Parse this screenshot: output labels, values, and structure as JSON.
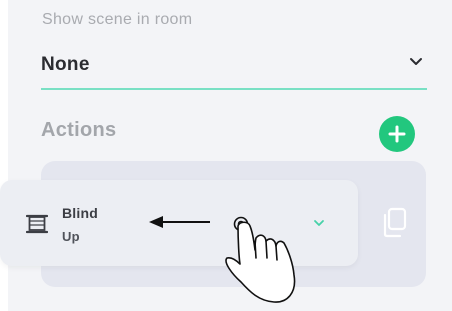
{
  "scene": {
    "label": "Show scene in room",
    "selected_value": "None",
    "dropdown_icon": "chevron-down-icon"
  },
  "actions": {
    "title": "Actions",
    "add_icon": "plus-icon",
    "items": [
      {
        "name": "Blind",
        "state": "Up",
        "icon": "blind-icon",
        "expand_icon": "chevron-down-icon"
      }
    ],
    "copy_icon": "copy-icon"
  },
  "gesture": {
    "icon": "hand-pointer-icon",
    "direction_icon": "arrow-left-icon"
  },
  "colors": {
    "accent_green": "#22c77e",
    "underline_teal": "#79e0c4",
    "chevron_teal": "#46d1a8",
    "background": "#f3f4f7"
  }
}
